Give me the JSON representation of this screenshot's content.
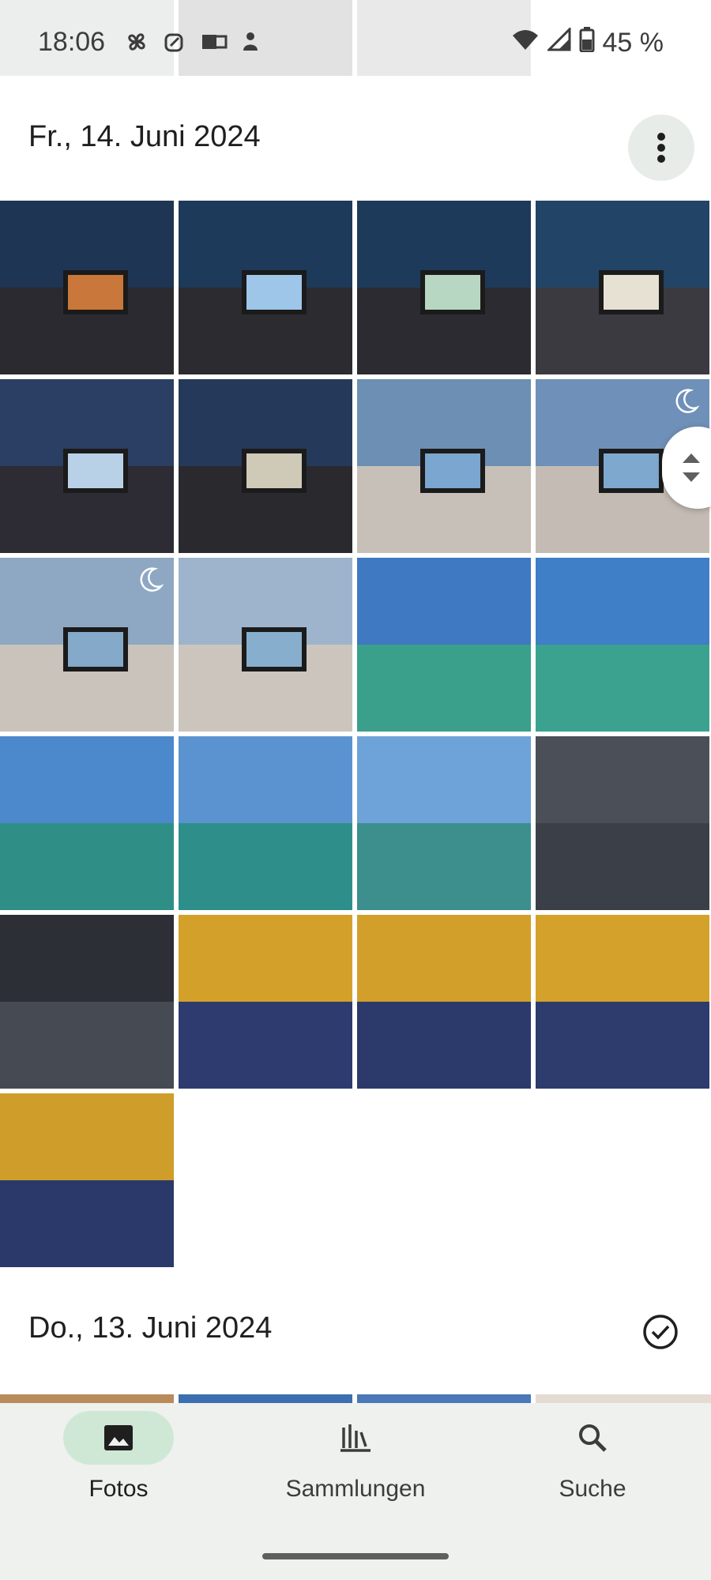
{
  "status_bar": {
    "time": "18:06",
    "battery": "45 %"
  },
  "sections": [
    {
      "date": "Fr., 14. Juni 2024",
      "photo_count": 21
    },
    {
      "date": "Do., 13. Juni 2024"
    }
  ],
  "icons": {
    "more": "more-vert-icon",
    "select_all": "check-circle-icon",
    "scroll": "unfold-icon"
  },
  "bottom_nav": {
    "items": [
      {
        "label": "Fotos",
        "icon": "photo-icon",
        "active": true
      },
      {
        "label": "Sammlungen",
        "icon": "collections-icon",
        "active": false
      },
      {
        "label": "Suche",
        "icon": "search-icon",
        "active": false
      }
    ]
  },
  "colors": {
    "accent": "#cfe8d6",
    "nav_bg": "#eef1ee"
  }
}
